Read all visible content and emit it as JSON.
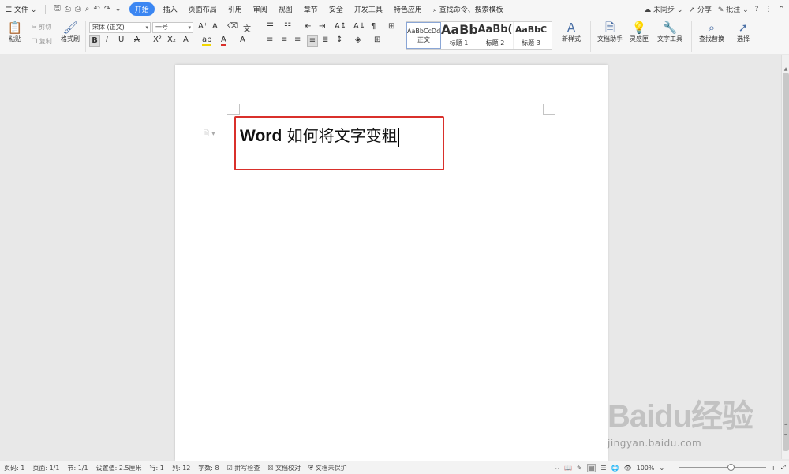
{
  "menubar": {
    "file_menu": "文件",
    "tabs": [
      "开始",
      "插入",
      "页面布局",
      "引用",
      "审阅",
      "视图",
      "章节",
      "安全",
      "开发工具",
      "特色应用"
    ],
    "active_tab": "开始",
    "search": "查找命令、搜索模板",
    "sync": "未同步",
    "share": "分享",
    "comment": "批注",
    "help": "?"
  },
  "ribbon": {
    "paste": "粘贴",
    "cut": "剪切",
    "copy": "复制",
    "format_painter": "格式刷",
    "font_name": "宋体 (正文)",
    "font_size": "一号",
    "styles": [
      {
        "sample": "AaBbCcDd",
        "label": "正文"
      },
      {
        "sample": "AaBb",
        "label": "标题 1"
      },
      {
        "sample": "AaBb(",
        "label": "标题 2"
      },
      {
        "sample": "AaBbC",
        "label": "标题 3"
      }
    ],
    "new_style": "新样式",
    "doc_helper": "文档助手",
    "inspiration": "灵感匣",
    "text_tools": "文字工具",
    "find_replace": "查找替换",
    "select": "选择"
  },
  "document": {
    "bold_word": "Word",
    "rest_text": "如何将文字变粗"
  },
  "statusbar": {
    "page_no": "页码: 1",
    "pages": "页面: 1/1",
    "section": "节: 1/1",
    "setting": "设置值: 2.5厘米",
    "row": "行: 1",
    "col": "列: 12",
    "word_count": "字数: 8",
    "spell_check": "拼写检查",
    "proofread": "文档校对",
    "protect": "文档未保护",
    "zoom": "100%",
    "zoom_level": 0.6
  },
  "watermark": {
    "brand": "Baidu经验",
    "url": "jingyan.baidu.com"
  }
}
